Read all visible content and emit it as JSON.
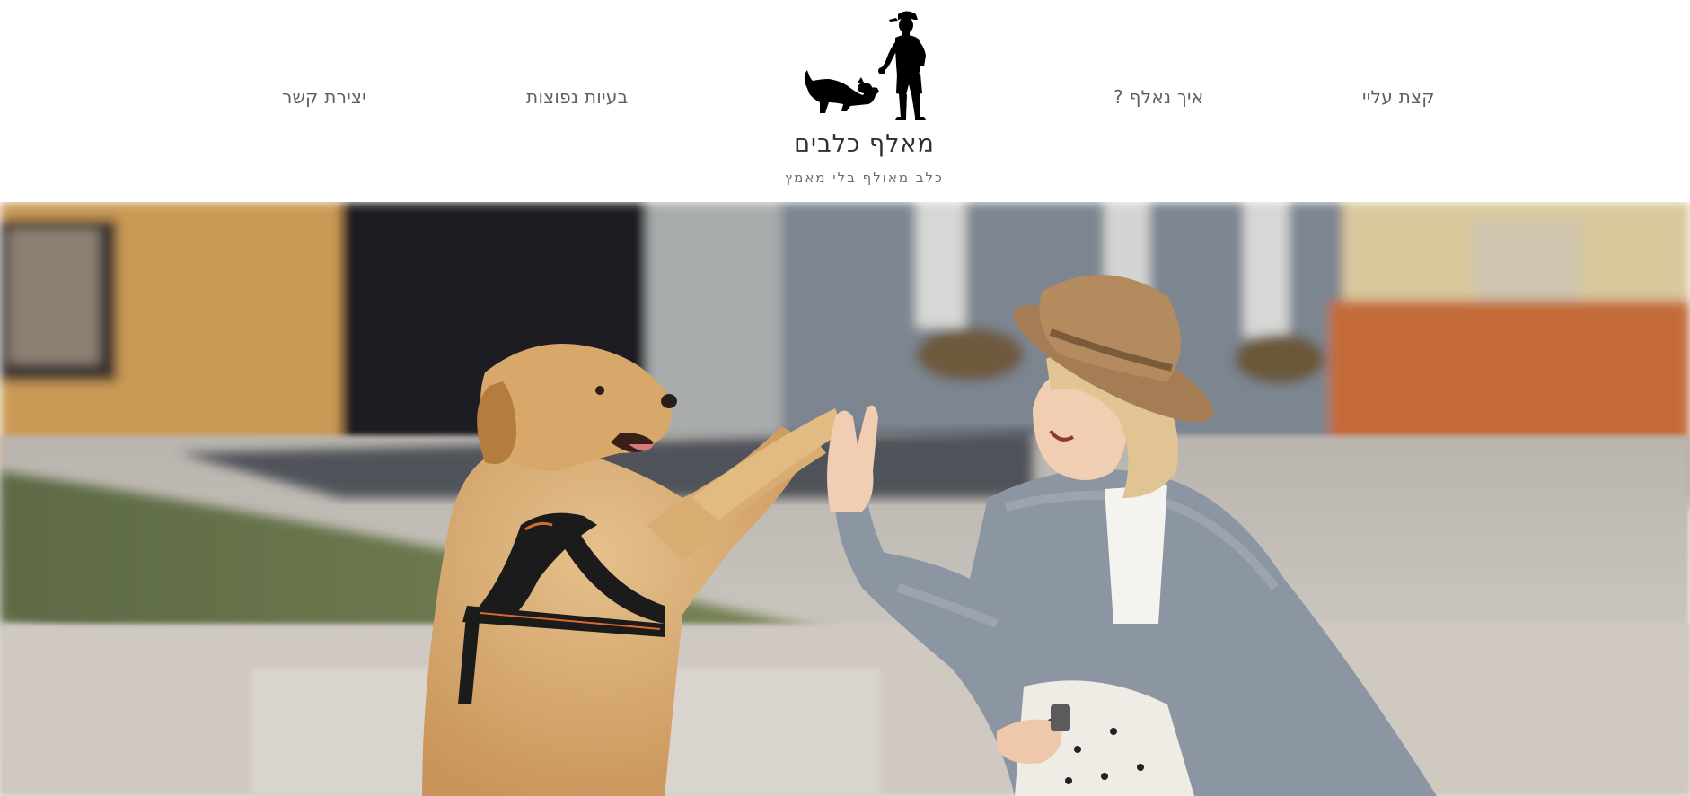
{
  "nav": {
    "items": [
      {
        "id": "about",
        "label": "קצת עליי"
      },
      {
        "id": "how",
        "label": "איך נאלף ?"
      },
      {
        "id": "issues",
        "label": "בעיות נפוצות"
      },
      {
        "id": "contact",
        "label": "יצירת קשר"
      }
    ]
  },
  "logo": {
    "title": "מאלף כלבים",
    "tagline": "כלב מאולף בלי מאמץ",
    "icon": "dog-trainer-silhouette-icon"
  },
  "hero": {
    "image": "woman-high-five-dog-photo"
  },
  "colors": {
    "nav_text": "#5f5f5f",
    "logo_title": "#2f2f2f",
    "logo_tagline": "#6a6a6a",
    "background": "#ffffff"
  }
}
